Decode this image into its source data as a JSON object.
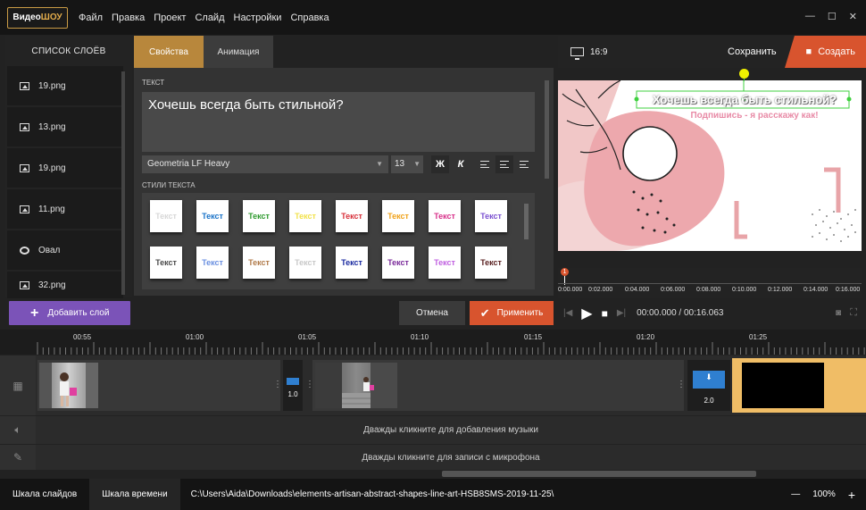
{
  "app": {
    "logo_a": "Видео",
    "logo_b": "ШОУ",
    "menu": [
      "Файл",
      "Правка",
      "Проект",
      "Слайд",
      "Настройки",
      "Справка"
    ]
  },
  "layers": {
    "title": "Список слоёв",
    "items": [
      {
        "label": "19.png",
        "icon": "image-icon"
      },
      {
        "label": "13.png",
        "icon": "image-icon"
      },
      {
        "label": "19.png",
        "icon": "image-icon"
      },
      {
        "label": "11.png",
        "icon": "image-icon"
      },
      {
        "label": "Овал",
        "icon": "oval-icon"
      },
      {
        "label": "32.png",
        "icon": "image-icon"
      }
    ],
    "add_label": "Добавить слой"
  },
  "props": {
    "tabs": [
      "Свойства",
      "Анимация"
    ],
    "text_section": "Текст",
    "text_value": "Хочешь всегда быть стильной?",
    "font": "Geometria LF Heavy",
    "size": "13",
    "bold_label": "Ж",
    "italic_label": "К",
    "styles_section": "Стили текста",
    "styles": [
      {
        "label": "Текст",
        "color": "#d8d8d8"
      },
      {
        "label": "Текст",
        "color": "#1a73c8"
      },
      {
        "label": "Текст",
        "color": "#2e9a2e"
      },
      {
        "label": "Текст",
        "color": "#f2e24a"
      },
      {
        "label": "Текст",
        "color": "#d8303a"
      },
      {
        "label": "Текст",
        "color": "#f0a21a"
      },
      {
        "label": "Текст",
        "color": "#d8308a"
      },
      {
        "label": "Текст",
        "color": "#7a4fd0"
      },
      {
        "label": "Текст",
        "color": "#4a4a4a"
      },
      {
        "label": "Текст",
        "color": "#6a8fe0"
      },
      {
        "label": "Текст",
        "color": "#b07a48"
      },
      {
        "label": "Текст",
        "color": "#c8c8c8"
      },
      {
        "label": "Текст",
        "color": "#1a2aa0"
      },
      {
        "label": "Текст",
        "color": "#7a2a9a"
      },
      {
        "label": "Текст",
        "color": "#c060e0"
      },
      {
        "label": "Текст",
        "color": "#5a2020"
      }
    ]
  },
  "actions": {
    "cancel": "Отмена",
    "apply": "Применить"
  },
  "preview": {
    "ratio": "16:9",
    "save": "Сохранить",
    "create": "Создать",
    "headline": "Хочешь всегда быть стильной?",
    "subline": "Подпишись - я расскажу как!",
    "ruler_labels": [
      "0:00.000",
      "0:02.000",
      "0:04.000",
      "0:06.000",
      "0:08.000",
      "0:10.000",
      "0:12.000",
      "0:14.000",
      "0:16.000"
    ],
    "marker": "1",
    "time": "00:00.000 / 00:16.063"
  },
  "timeline": {
    "ruler": [
      "00:55",
      "01:00",
      "01:05",
      "01:10",
      "01:15",
      "01:20",
      "01:25"
    ],
    "trans1": "1.0",
    "trans2": "2.0",
    "music_hint": "Дважды кликните для добавления музыки",
    "mic_hint": "Дважды кликните для записи с микрофона"
  },
  "status": {
    "tab_slides": "Шкала слайдов",
    "tab_time": "Шкала времени",
    "path": "C:\\Users\\Aida\\Downloads\\elements-artisan-abstract-shapes-line-art-HSB8SMS-2019-11-25\\",
    "zoom_minus": "—",
    "zoom": "100%",
    "zoom_plus": "+"
  }
}
